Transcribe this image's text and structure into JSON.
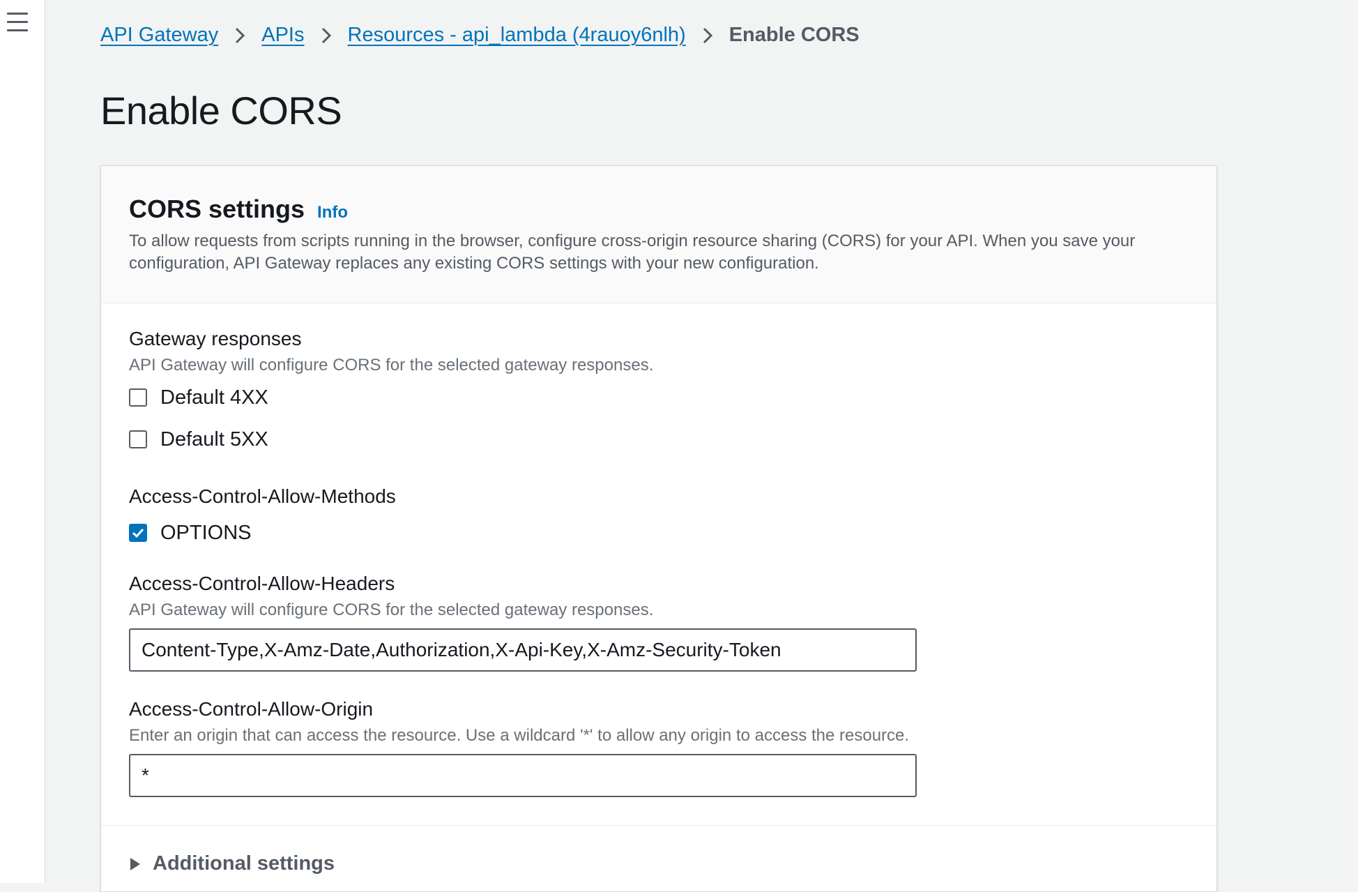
{
  "nav": {
    "menu_icon": "hamburger-menu-icon"
  },
  "breadcrumb": {
    "items": [
      {
        "label": "API Gateway"
      },
      {
        "label": "APIs"
      },
      {
        "label": "Resources - api_lambda (4rauoy6nlh)"
      }
    ],
    "current": "Enable CORS",
    "separator_icon": "chevron-right-icon"
  },
  "page": {
    "title": "Enable CORS"
  },
  "cors_settings": {
    "title": "CORS settings",
    "info_label": "Info",
    "description": "To allow requests from scripts running in the browser, configure cross-origin resource sharing (CORS) for your API. When you save your configuration, API Gateway replaces any existing CORS settings with your new configuration."
  },
  "gateway_responses": {
    "label": "Gateway responses",
    "description": "API Gateway will configure CORS for the selected gateway responses.",
    "options": [
      {
        "label": "Default 4XX",
        "checked": false
      },
      {
        "label": "Default 5XX",
        "checked": false
      }
    ]
  },
  "allow_methods": {
    "label": "Access-Control-Allow-Methods",
    "options": [
      {
        "label": "OPTIONS",
        "checked": true
      }
    ]
  },
  "allow_headers": {
    "label": "Access-Control-Allow-Headers",
    "description": "API Gateway will configure CORS for the selected gateway responses.",
    "value": "Content-Type,X-Amz-Date,Authorization,X-Api-Key,X-Amz-Security-Token"
  },
  "allow_origin": {
    "label": "Access-Control-Allow-Origin",
    "description": "Enter an origin that can access the resource. Use a wildcard '*' to allow any origin to access the resource.",
    "value": "*"
  },
  "additional_settings": {
    "label": "Additional settings",
    "expanded": false,
    "icon": "caret-right-icon"
  },
  "colors": {
    "link": "#0073bb",
    "background": "#f2f3f3",
    "checkbox_checked": "#0073bb"
  }
}
